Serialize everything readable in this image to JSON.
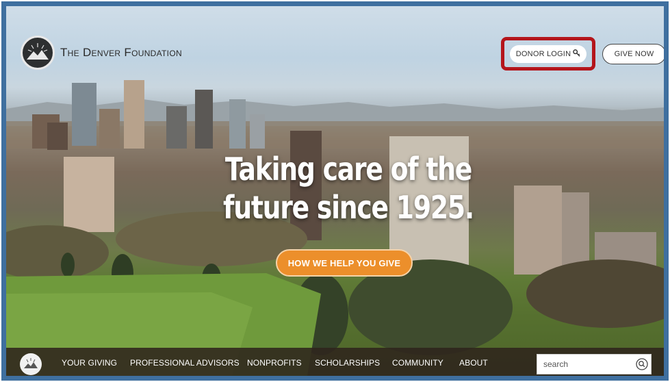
{
  "header": {
    "logo_text": "The Denver Foundation",
    "donor_login_label": "DONOR LOGIN",
    "give_now_label": "GIVE NOW"
  },
  "hero": {
    "headline_line1": "Taking care of the",
    "headline_line2": "future since 1925.",
    "cta_label": "HOW WE HELP YOU GIVE"
  },
  "nav": {
    "items": [
      {
        "label": "YOUR GIVING"
      },
      {
        "label": "PROFESSIONAL ADVISORS"
      },
      {
        "label": "NONPROFITS"
      },
      {
        "label": "SCHOLARSHIPS"
      },
      {
        "label": "COMMUNITY"
      },
      {
        "label": "ABOUT"
      }
    ],
    "search_placeholder": "search"
  },
  "icons": {
    "donor_login": "key-icon",
    "search": "search-icon",
    "logo": "mountain-sun-logo-icon"
  },
  "colors": {
    "highlight_border": "#b4151b",
    "cta_background": "#ec8f2b",
    "frame_border": "#3f6f9f",
    "nav_background": "#2f241c"
  }
}
